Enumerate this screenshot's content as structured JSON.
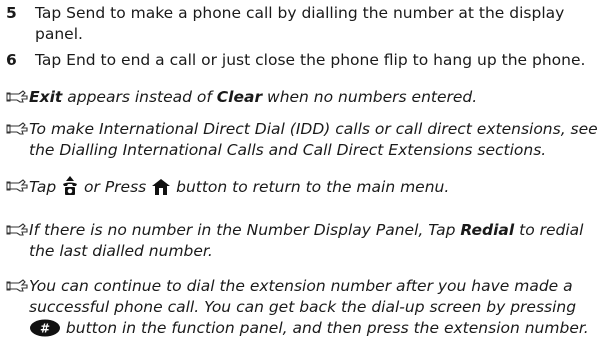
{
  "steps": [
    {
      "number": "5",
      "lines": [
        "Tap Send to make a phone call by dialling the number at the display",
        "panel."
      ]
    },
    {
      "number": "6",
      "lines": [
        "Tap End to end a call or just close the phone flip to hang up the phone."
      ]
    }
  ],
  "notes": {
    "exit": {
      "bold1": "Exit",
      "mid": " appears instead of ",
      "bold2": "Clear",
      "end": " when no numbers entered."
    },
    "idd": {
      "line1": "To make International Direct Dial (IDD) calls or call direct extensions, see",
      "line2": "the Dialling International Calls and Call Direct Extensions sections."
    },
    "home": {
      "a": "Tap ",
      "b": " or Press ",
      "c": " button to return to the main menu."
    },
    "redial": {
      "line1": "If there is no number in the Number Display Panel, Tap ",
      "bold": "Redial",
      "line1_end": " to redial",
      "line2": "the last dialled number."
    },
    "extension": {
      "line1": "You can continue to dial the extension number after you have made a",
      "line2": "successful phone call. You can get back the dial-up screen by pressing",
      "line3_after": " button in the function panel, and then press the extension number.",
      "key_label": "#"
    }
  },
  "icons": [
    "note-hand-icon",
    "phone-icon",
    "home-icon",
    "hash-key-icon"
  ],
  "colors": {
    "text": "#1a1a1a"
  }
}
